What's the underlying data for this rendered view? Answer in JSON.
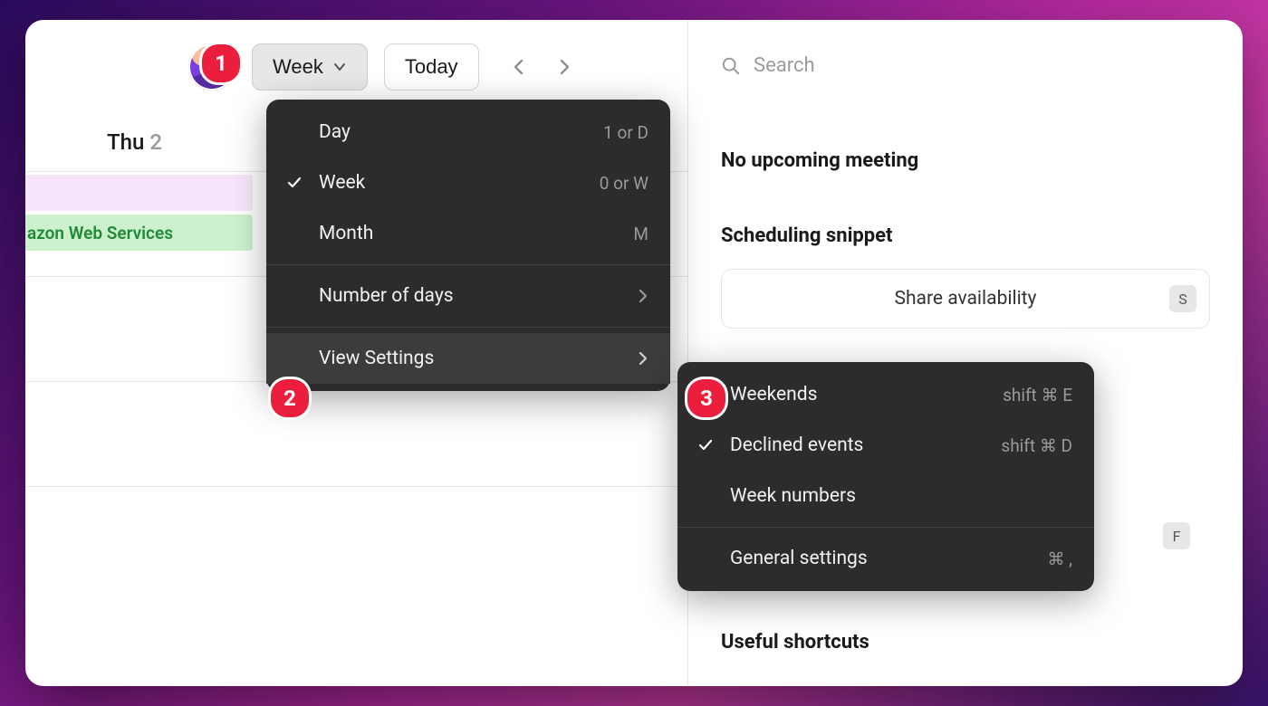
{
  "toolbar": {
    "view_label": "Week",
    "today_label": "Today"
  },
  "calendar": {
    "day_short": "Thu",
    "day_num": "2",
    "events": {
      "aws": "azon Web Services"
    }
  },
  "search": {
    "placeholder": "Search"
  },
  "sidebar": {
    "no_meeting": "No upcoming meeting",
    "scheduling_title": "Scheduling snippet",
    "share_label": "Share availability",
    "share_key": "S",
    "useful_shortcuts": "Useful shortcuts",
    "f_key": "F"
  },
  "menu_view": {
    "day": {
      "label": "Day",
      "hint": "1 or D"
    },
    "week": {
      "label": "Week",
      "hint": "0 or W"
    },
    "month": {
      "label": "Month",
      "hint": "M"
    },
    "numdays": {
      "label": "Number of days"
    },
    "settings": {
      "label": "View Settings"
    }
  },
  "menu_settings": {
    "weekends": {
      "label": "Weekends",
      "hint": "shift ⌘ E"
    },
    "declined": {
      "label": "Declined events",
      "hint": "shift ⌘ D"
    },
    "weeknums": {
      "label": "Week numbers"
    },
    "general": {
      "label": "General settings",
      "hint": "⌘ ,"
    }
  },
  "annotations": {
    "one": "1",
    "two": "2",
    "three": "3"
  }
}
